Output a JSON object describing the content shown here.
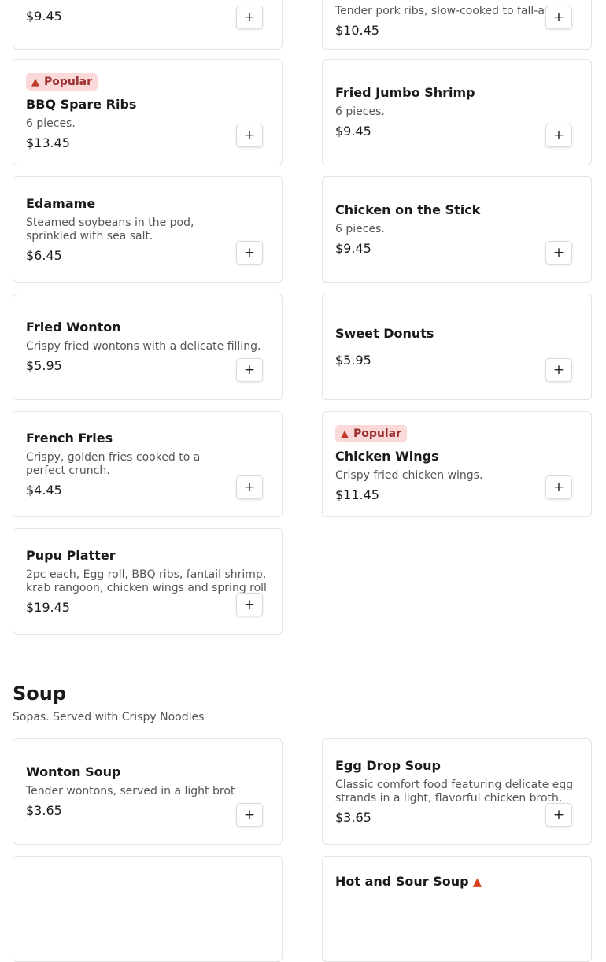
{
  "appetizers": {
    "items": [
      {
        "title": "",
        "desc": "",
        "price": "$9.45",
        "popular": false
      },
      {
        "title": "",
        "desc": "Tender pork ribs, slow-cooked to fall-apart.",
        "price": "$10.45",
        "popular": false
      },
      {
        "title": "BBQ Spare Ribs",
        "desc": "6 pieces.",
        "price": "$13.45",
        "popular": true
      },
      {
        "title": "Fried Jumbo Shrimp",
        "desc": "6 pieces.",
        "price": "$9.45",
        "popular": false
      },
      {
        "title": "Edamame",
        "desc": "Steamed soybeans in the pod, sprinkled with sea salt.",
        "price": "$6.45",
        "popular": false
      },
      {
        "title": "Chicken on the Stick",
        "desc": "6 pieces.",
        "price": "$9.45",
        "popular": false
      },
      {
        "title": "Fried Wonton",
        "desc": "Crispy fried wontons with a delicate filling.",
        "price": "$5.95",
        "popular": false
      },
      {
        "title": "Sweet Donuts",
        "desc": "",
        "price": "$5.95",
        "popular": false
      },
      {
        "title": "French Fries",
        "desc": "Crispy, golden fries cooked to a perfect crunch.",
        "price": "$4.45",
        "popular": false
      },
      {
        "title": "Chicken Wings",
        "desc": "Crispy fried chicken wings.",
        "price": "$11.45",
        "popular": true
      },
      {
        "title": "Pupu Platter",
        "desc": "2pc each, Egg roll, BBQ ribs, fantail shrimp, krab rangoon, chicken wings and spring roll",
        "price": "$19.45",
        "popular": false
      }
    ]
  },
  "badge": {
    "label": "Popular",
    "icon": "fire-icon"
  },
  "add_button": {
    "label": "+"
  },
  "soup": {
    "title": "Soup",
    "subtitle": "Sopas. Served with Crispy Noodles",
    "items": [
      {
        "title": "Wonton Soup",
        "desc": "Tender wontons, served in a light broth.",
        "price": "$3.65"
      },
      {
        "title": "Egg Drop Soup",
        "desc": "Classic comfort food featuring delicate egg strands in a light, flavorful chicken broth.",
        "price": "$3.65"
      },
      {
        "title": "",
        "desc": "",
        "price": ""
      },
      {
        "title": "Hot and Sour Soup",
        "desc": "",
        "price": "",
        "spicy": true
      }
    ]
  },
  "colors": {
    "badge_bg": "#fbd9d9",
    "badge_text": "#9b2f2f",
    "border": "#e3e3e3"
  }
}
